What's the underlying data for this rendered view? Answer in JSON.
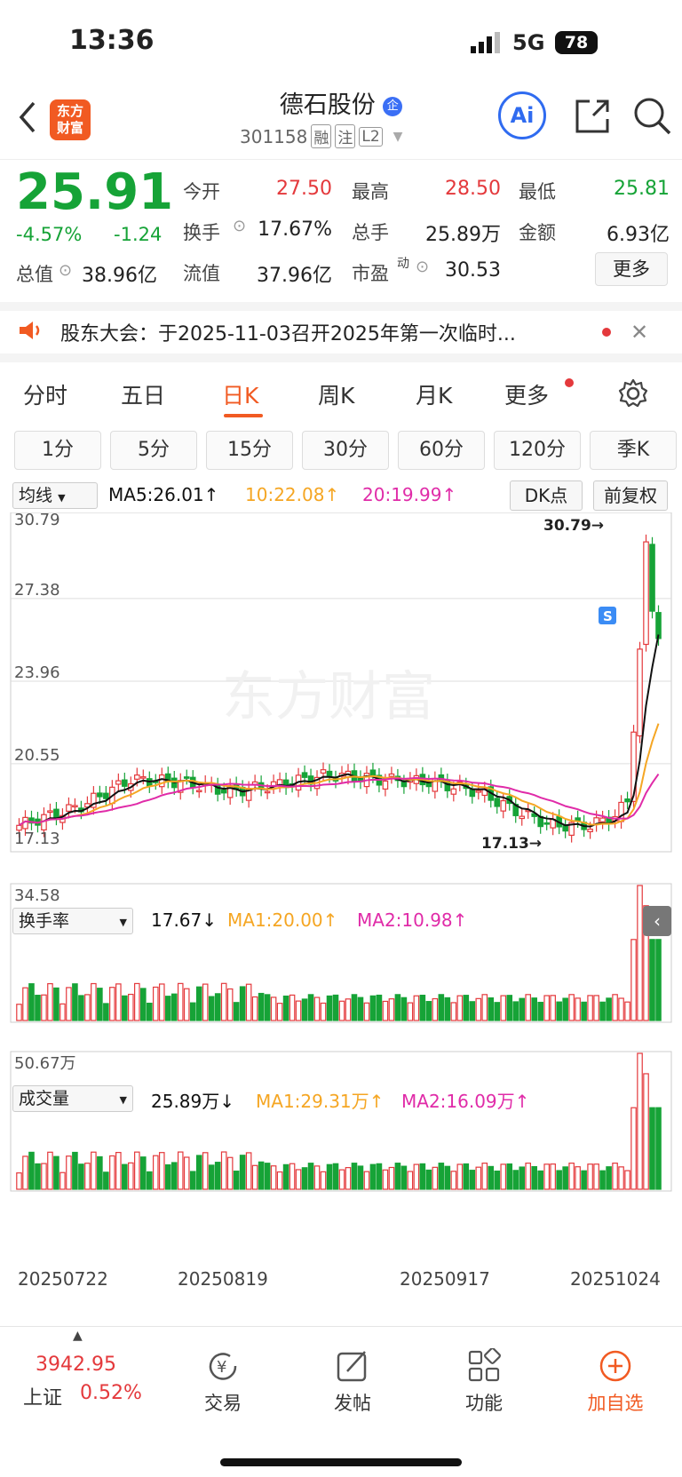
{
  "status": {
    "time": "13:36",
    "network": "5G",
    "battery": "78"
  },
  "header": {
    "logo_text": "东方\n财富",
    "name": "德石股份",
    "code": "301158",
    "tag1": "融",
    "tag2": "注",
    "tag3": "L2",
    "ai": "Ai"
  },
  "quote": {
    "price": "25.91",
    "pct": "-4.57%",
    "chg": "-1.24",
    "open_label": "今开",
    "open": "27.50",
    "high_label": "最高",
    "high": "28.50",
    "low_label": "最低",
    "low": "25.81",
    "turnover_label": "换手",
    "turnover": "17.67%",
    "volume_label": "总手",
    "volume": "25.89万",
    "amount_label": "金额",
    "amount": "6.93亿",
    "mcap_label": "总值",
    "mcap": "38.96亿",
    "float_label": "流值",
    "float": "37.96亿",
    "pe_label": "市盈",
    "pe_sup": "动",
    "pe": "30.53",
    "more": "更多"
  },
  "notice": {
    "text": "股东大会：于2025-11-03召开2025年第一次临时..."
  },
  "tabs": [
    "分时",
    "五日",
    "日K",
    "周K",
    "月K",
    "更多"
  ],
  "active_tab": 2,
  "periods": [
    "1分",
    "5分",
    "15分",
    "30分",
    "60分",
    "120分",
    "季K"
  ],
  "kline": {
    "selector": "均线",
    "ma5": "MA5:26.01↑",
    "ma10": "10:22.08↑",
    "ma20": "20:19.99↑",
    "dk": "DK点",
    "fq": "前复权",
    "y_labels": [
      "30.79",
      "27.38",
      "23.96",
      "20.55",
      "17.13"
    ],
    "max_label": "30.79→",
    "min_label": "17.13→",
    "watermark": "东方财富",
    "s_badge": "S"
  },
  "turnover_ind": {
    "selector": "换手率",
    "value": "17.67↓",
    "ma1": "MA1:20.00↑",
    "ma2": "MA2:10.98↑",
    "top": "34.58"
  },
  "volume_ind": {
    "selector": "成交量",
    "value": "25.89万↓",
    "ma1": "MA1:29.31万↑",
    "ma2": "MA2:16.09万↑",
    "top": "50.67万"
  },
  "dates": [
    "20250722",
    "20250819",
    "20250917",
    "20251024"
  ],
  "bottom": {
    "index_value": "3942.95",
    "index_name": "上证",
    "index_pct": "0.52%",
    "trade": "交易",
    "post": "发帖",
    "func": "功能",
    "add": "加自选"
  },
  "colors": {
    "up": "#e4393c",
    "down": "#16a337",
    "accent": "#f15a22",
    "ma5": "#111111",
    "ma10": "#f5a623",
    "ma20": "#e02ba8"
  },
  "chart_data": {
    "type": "candlestick",
    "note": "daily K-line",
    "last_close": 25.91,
    "high": 30.79,
    "low": 17.13
  }
}
